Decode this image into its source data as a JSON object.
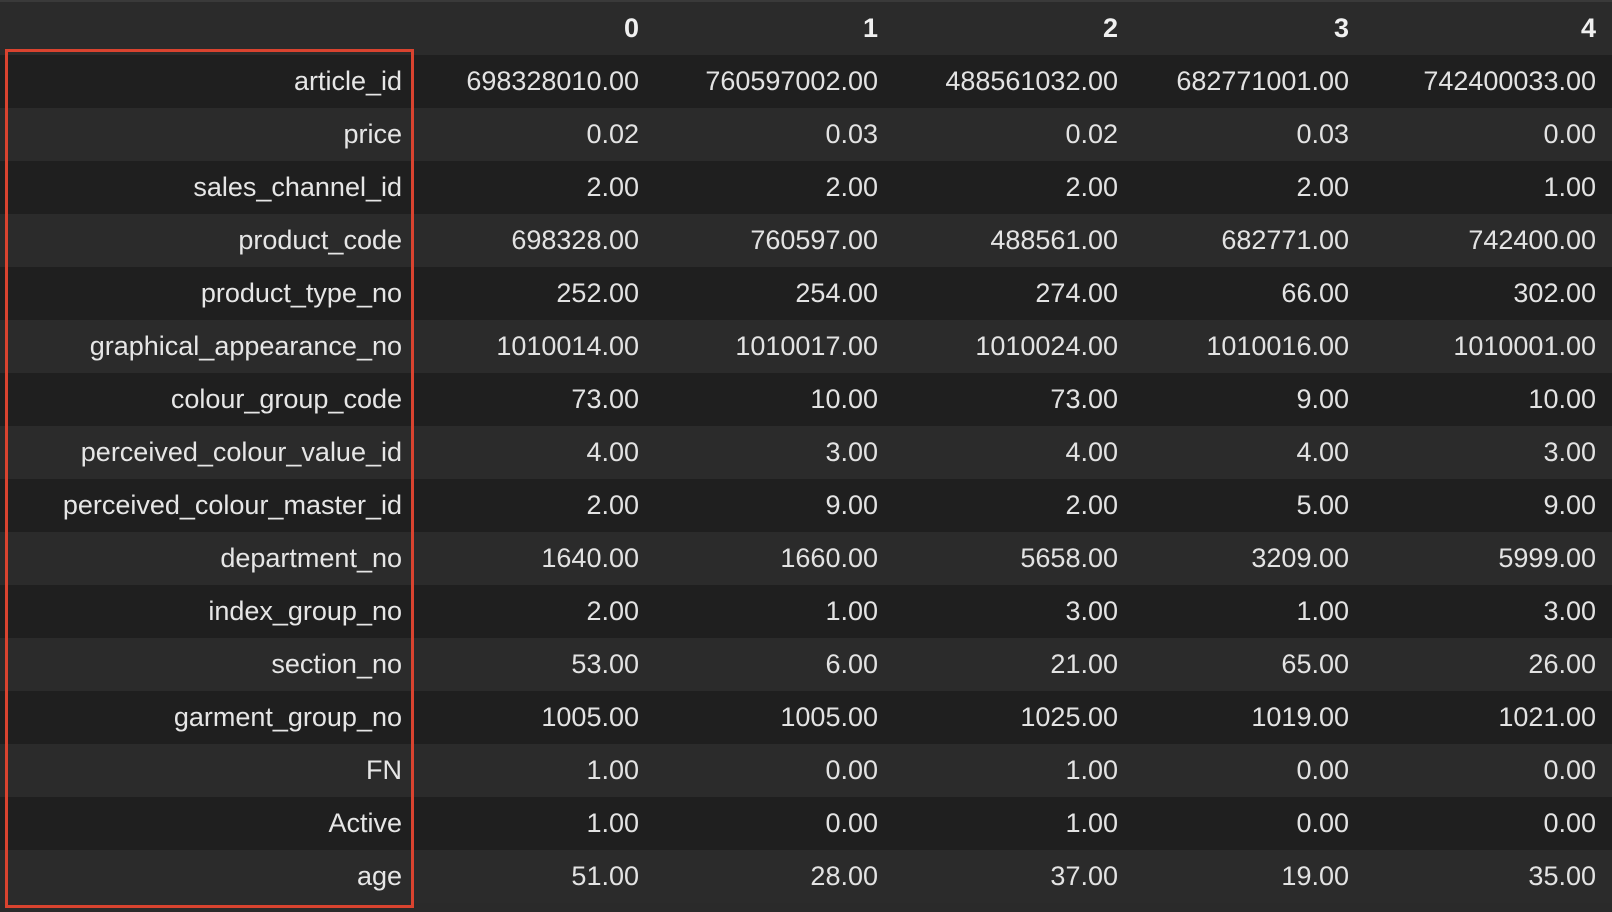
{
  "table": {
    "columns": [
      "0",
      "1",
      "2",
      "3",
      "4"
    ],
    "rows": [
      {
        "label": "article_id",
        "values": [
          "698328010.00",
          "760597002.00",
          "488561032.00",
          "682771001.00",
          "742400033.00"
        ]
      },
      {
        "label": "price",
        "values": [
          "0.02",
          "0.03",
          "0.02",
          "0.03",
          "0.00"
        ]
      },
      {
        "label": "sales_channel_id",
        "values": [
          "2.00",
          "2.00",
          "2.00",
          "2.00",
          "1.00"
        ]
      },
      {
        "label": "product_code",
        "values": [
          "698328.00",
          "760597.00",
          "488561.00",
          "682771.00",
          "742400.00"
        ]
      },
      {
        "label": "product_type_no",
        "values": [
          "252.00",
          "254.00",
          "274.00",
          "66.00",
          "302.00"
        ]
      },
      {
        "label": "graphical_appearance_no",
        "values": [
          "1010014.00",
          "1010017.00",
          "1010024.00",
          "1010016.00",
          "1010001.00"
        ]
      },
      {
        "label": "colour_group_code",
        "values": [
          "73.00",
          "10.00",
          "73.00",
          "9.00",
          "10.00"
        ]
      },
      {
        "label": "perceived_colour_value_id",
        "values": [
          "4.00",
          "3.00",
          "4.00",
          "4.00",
          "3.00"
        ]
      },
      {
        "label": "perceived_colour_master_id",
        "values": [
          "2.00",
          "9.00",
          "2.00",
          "5.00",
          "9.00"
        ]
      },
      {
        "label": "department_no",
        "values": [
          "1640.00",
          "1660.00",
          "5658.00",
          "3209.00",
          "5999.00"
        ]
      },
      {
        "label": "index_group_no",
        "values": [
          "2.00",
          "1.00",
          "3.00",
          "1.00",
          "3.00"
        ]
      },
      {
        "label": "section_no",
        "values": [
          "53.00",
          "6.00",
          "21.00",
          "65.00",
          "26.00"
        ]
      },
      {
        "label": "garment_group_no",
        "values": [
          "1005.00",
          "1005.00",
          "1025.00",
          "1019.00",
          "1021.00"
        ]
      },
      {
        "label": "FN",
        "values": [
          "1.00",
          "0.00",
          "1.00",
          "0.00",
          "0.00"
        ]
      },
      {
        "label": "Active",
        "values": [
          "1.00",
          "0.00",
          "1.00",
          "0.00",
          "0.00"
        ]
      },
      {
        "label": "age",
        "values": [
          "51.00",
          "28.00",
          "37.00",
          "19.00",
          "35.00"
        ]
      }
    ]
  },
  "colors": {
    "background": "#2a2a2a",
    "row_dark": "#1f1f1f",
    "row_light": "#2b2b2b",
    "text": "#e3e3e3",
    "highlight_border": "#d9432f"
  }
}
